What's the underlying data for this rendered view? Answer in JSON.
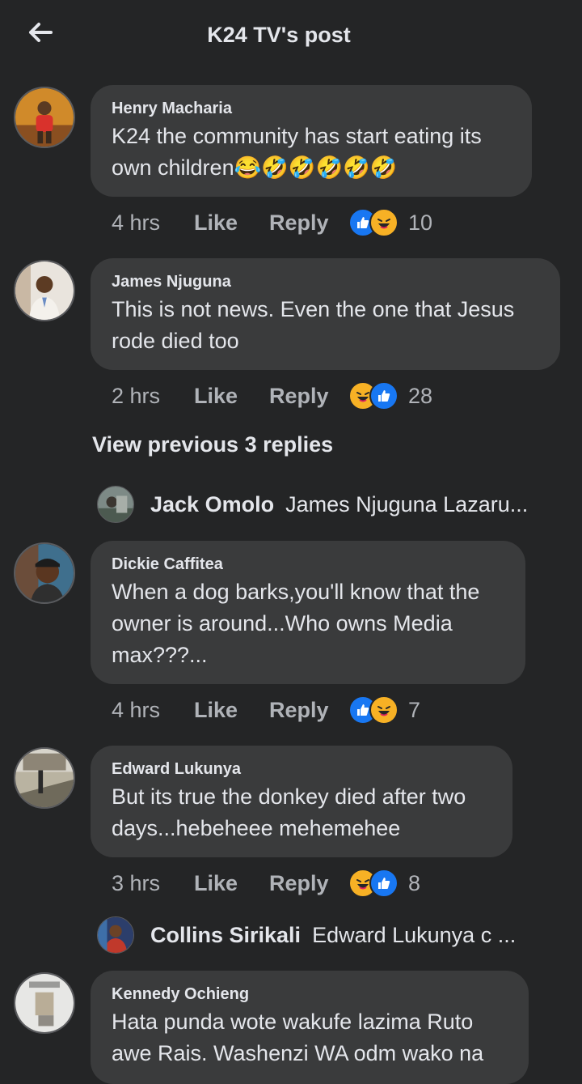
{
  "header": {
    "title": "K24 TV's post",
    "back_icon": "arrow-left-icon"
  },
  "colors": {
    "background": "#242526",
    "bubble": "#3a3b3c",
    "like_blue": "#1877f2",
    "haha_yellow": "#f7b125"
  },
  "comments": [
    {
      "author": "Henry Macharia",
      "text": "K24 the community has start eating its own children😂🤣🤣🤣🤣🤣",
      "time": "4 hrs",
      "like": "Like",
      "reply": "Reply",
      "reactions": [
        "like",
        "haha"
      ],
      "count": "10"
    },
    {
      "author": "James Njuguna",
      "text": "This is not news. Even the one that Jesus rode died too",
      "time": "2 hrs",
      "like": "Like",
      "reply": "Reply",
      "reactions": [
        "haha",
        "like"
      ],
      "count": "28"
    },
    {
      "author": "Dickie Caffitea",
      "text": "When a dog barks,you'll know that the owner is around...Who owns Media max???...",
      "time": "4 hrs",
      "like": "Like",
      "reply": "Reply",
      "reactions": [
        "like",
        "haha"
      ],
      "count": "7"
    },
    {
      "author": "Edward Lukunya",
      "text": "But its true the donkey died after two days...hebeheee mehemehee",
      "time": "3 hrs",
      "like": "Like",
      "reply": "Reply",
      "reactions": [
        "haha",
        "like"
      ],
      "count": "8"
    },
    {
      "author": "Kennedy Ochieng",
      "text": "Hata punda wote wakufe lazima Ruto awe Rais. Washenzi WA odm wako na"
    }
  ],
  "view_previous": "View previous 3 replies",
  "replies": [
    {
      "author": "Jack Omolo",
      "snippet": "James Njuguna Lazaru..."
    },
    {
      "author": "Collins Sirikali",
      "snippet": "Edward Lukunya c ..."
    }
  ]
}
